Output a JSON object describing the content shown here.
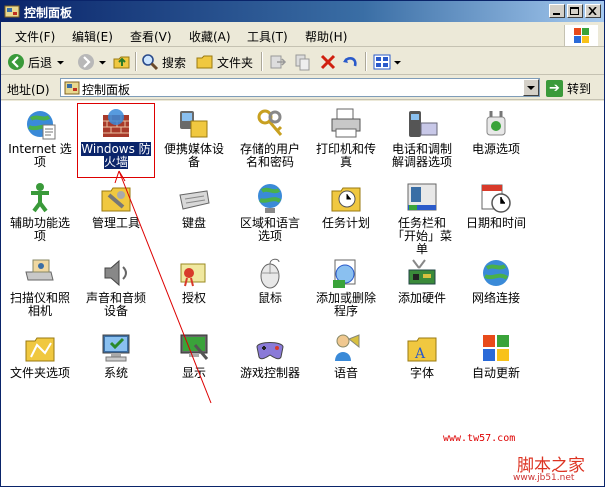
{
  "window": {
    "title": "控制面板"
  },
  "menu": [
    "文件(F)",
    "编辑(E)",
    "查看(V)",
    "收藏(A)",
    "工具(T)",
    "帮助(H)"
  ],
  "toolbar": {
    "back": "后退",
    "search": "搜索",
    "folders": "文件夹"
  },
  "address": {
    "label": "地址(D)",
    "value": "控制面板",
    "go": "转到"
  },
  "items": [
    {
      "label": "Internet 选项",
      "icon": "globe-icon"
    },
    {
      "label": "Windows 防火墙",
      "icon": "firewall-icon",
      "selected": true
    },
    {
      "label": "便携媒体设备",
      "icon": "media-device-icon"
    },
    {
      "label": "存储的用户名和密码",
      "icon": "keys-icon"
    },
    {
      "label": "打印机和传真",
      "icon": "printer-icon"
    },
    {
      "label": "电话和调制解调器选项",
      "icon": "phone-icon"
    },
    {
      "label": "电源选项",
      "icon": "power-icon"
    },
    {
      "label": "辅助功能选项",
      "icon": "accessibility-icon"
    },
    {
      "label": "管理工具",
      "icon": "admin-tools-icon"
    },
    {
      "label": "键盘",
      "icon": "keyboard-icon"
    },
    {
      "label": "区域和语言选项",
      "icon": "region-globe-icon"
    },
    {
      "label": "任务计划",
      "icon": "scheduled-tasks-icon"
    },
    {
      "label": "任务栏和「开始」菜单",
      "icon": "taskbar-icon"
    },
    {
      "label": "日期和时间",
      "icon": "clock-icon"
    },
    {
      "label": "扫描仪和照相机",
      "icon": "scanner-icon"
    },
    {
      "label": "声音和音频设备",
      "icon": "speaker-icon"
    },
    {
      "label": "授权",
      "icon": "license-icon"
    },
    {
      "label": "鼠标",
      "icon": "mouse-icon"
    },
    {
      "label": "添加或删除程序",
      "icon": "add-remove-icon"
    },
    {
      "label": "添加硬件",
      "icon": "add-hardware-icon"
    },
    {
      "label": "网络连接",
      "icon": "network-icon"
    },
    {
      "label": "文件夹选项",
      "icon": "folder-options-icon"
    },
    {
      "label": "系统",
      "icon": "system-icon"
    },
    {
      "label": "显示",
      "icon": "display-icon"
    },
    {
      "label": "游戏控制器",
      "icon": "gamepad-icon"
    },
    {
      "label": "语音",
      "icon": "speech-icon"
    },
    {
      "label": "字体",
      "icon": "fonts-icon"
    },
    {
      "label": "自动更新",
      "icon": "update-icon"
    }
  ],
  "watermark": {
    "site": "www.tw57.com",
    "brand": "脚本之家",
    "url": "www.jb51.net"
  }
}
